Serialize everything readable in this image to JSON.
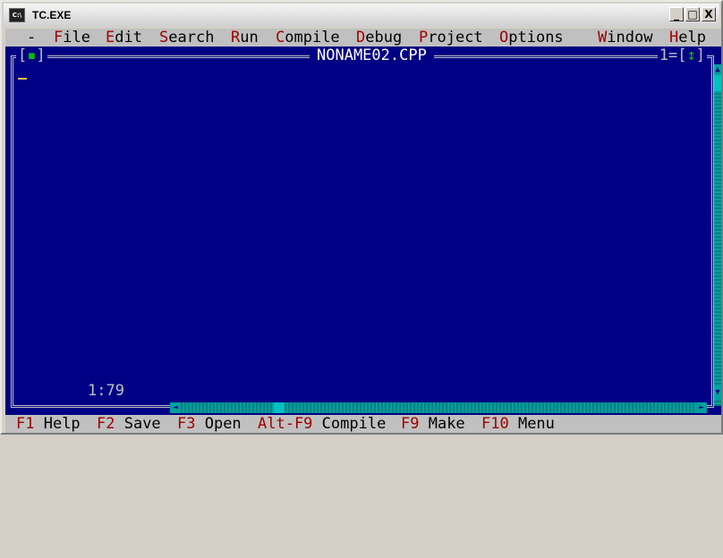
{
  "window": {
    "title": "TC.EXE",
    "icon": "C:\\"
  },
  "winbtns": {
    "minimize": "_",
    "maximize": "□",
    "close": "X"
  },
  "menu": {
    "system": "-",
    "items": [
      {
        "hotkey": "F",
        "rest": "ile"
      },
      {
        "hotkey": "E",
        "rest": "dit"
      },
      {
        "hotkey": "S",
        "rest": "earch"
      },
      {
        "hotkey": "R",
        "rest": "un"
      },
      {
        "hotkey": "C",
        "rest": "ompile"
      },
      {
        "hotkey": "D",
        "rest": "ebug"
      },
      {
        "hotkey": "P",
        "rest": "roject"
      },
      {
        "hotkey": "O",
        "rest": "ptions"
      },
      {
        "hotkey": "W",
        "rest": "indow"
      },
      {
        "hotkey": "H",
        "rest": "elp"
      }
    ]
  },
  "editor": {
    "filename": "NONAME02.CPP",
    "close_box_left": "[",
    "close_box_mark": "▪",
    "close_box_right": "]",
    "window_number": "1",
    "zoom_left": "=[",
    "zoom_mark": "↕",
    "zoom_right": "]",
    "cursor_pos": "1:79"
  },
  "scroll": {
    "up": "▲",
    "down": "▼",
    "left": "◄",
    "right": "►"
  },
  "statusbar": [
    {
      "key": "F1",
      "label": " Help"
    },
    {
      "key": "F2",
      "label": " Save"
    },
    {
      "key": "F3",
      "label": " Open"
    },
    {
      "key": "Alt-F9",
      "label": " Compile"
    },
    {
      "key": "F9",
      "label": " Make"
    },
    {
      "key": "F10",
      "label": " Menu"
    }
  ]
}
